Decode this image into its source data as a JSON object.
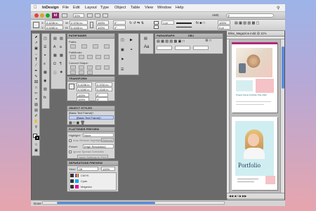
{
  "menubar": {
    "app": "InDesign",
    "items": [
      "File",
      "Edit",
      "Layout",
      "Type",
      "Object",
      "Table",
      "View",
      "Window",
      "Help"
    ]
  },
  "appbar": {
    "zoom": "33%",
    "workspace": "AMC",
    "search_placeholder": ""
  },
  "control": {
    "x": "0.4236 in",
    "y": "0.5285 in",
    "w": "2.3781 in",
    "h": "0.4345 in",
    "scale_x": "100%",
    "scale_y": "100%",
    "angle": "0°",
    "shear": "0°",
    "stroke": "1 pt",
    "opacity": "100%",
    "tint": "0 pt"
  },
  "pathfinder": {
    "title": "PATHFINDER",
    "sections": [
      "Paths:",
      "Pathfinder:",
      "Convert Shape:"
    ]
  },
  "transform": {
    "title": "TRANSFORM",
    "x": "0.4236 in",
    "y": "0.5285 in",
    "w": "2.3781 in",
    "h": "0.4345 in",
    "sx": "100%",
    "sy": "100%",
    "angle": "0°",
    "shear": "0°"
  },
  "object_styles": {
    "title": "OBJECT STYLES",
    "current": "[Basic Text Frame]+",
    "items": [
      "[Basic Text Frame]+"
    ]
  },
  "flattener": {
    "title": "FLATTENER PREVIEW",
    "highlight_label": "Highlight:",
    "highlight_value": "None",
    "auto_refresh": "Auto Refresh Highlight",
    "refresh": "Refresh",
    "preset_label": "Preset:",
    "preset_value": "[High Resolution]",
    "ignore": "Ignore Spread Overrides",
    "apply": "Apply Settings to Print"
  },
  "separations": {
    "title": "SEPARATIONS PREVIEW",
    "view_label": "View:",
    "view_value": "Off",
    "zoom_value": "100%",
    "inks": [
      "CMYK",
      "Cyan",
      "Magenta"
    ]
  },
  "paragraph": {
    "title": "PARAGRAPH",
    "tab2": "OBJ"
  },
  "document": {
    "tab": "Bliss_Magazine.indd @ 11%",
    "page2_title": "Portfolio",
    "page1_caption": "Project Name Portfolio Title 2022"
  },
  "status": {
    "text": "Done",
    "page": "3"
  }
}
